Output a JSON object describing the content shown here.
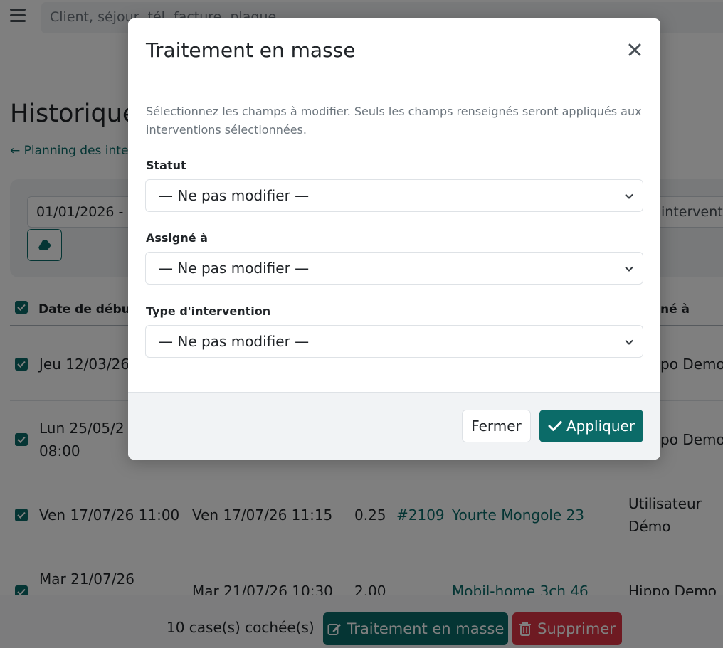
{
  "colors": {
    "accent": "#0b6b68",
    "danger": "#dc3545",
    "muted": "#6c757d"
  },
  "topbar": {
    "search_placeholder": "Client, séjour, tél, facture, plaque"
  },
  "page": {
    "title": "Historique",
    "back_link": "← Planning des inter"
  },
  "filters": {
    "date_value": "01/01/2026 -",
    "type_value": "intervent"
  },
  "table": {
    "headers": {
      "start": "Date de début",
      "assigned": "né à"
    },
    "rows": [
      {
        "start": "Jeu 12/03/26",
        "assigned": "po Demo"
      },
      {
        "start": "Lun 25/05/2",
        "start_time": "08:00",
        "assigned": "po Demo"
      },
      {
        "start": "Ven 17/07/26 11:00",
        "end": "Ven 17/07/26 11:15",
        "duration": "0.25",
        "number": "#2109",
        "location": "Yourte Mongole 23",
        "assigned": "Utilisateur Démo"
      },
      {
        "start": "Mar 21/07/26",
        "end": "Mar 21/07/26 10:30",
        "duration": "2.00",
        "location": "Mobil-home 3ch 46",
        "assigned": "Hippo Demo"
      }
    ]
  },
  "bulk_bar": {
    "count": "10 case(s) cochée(s)",
    "mass_label": "Traitement en masse",
    "delete_label": "Supprimer"
  },
  "modal": {
    "title": "Traitement en masse",
    "helper": "Sélectionnez les champs à modifier. Seuls les champs renseignés seront appliqués aux interventions sélectionnées.",
    "fields": [
      {
        "label": "Statut",
        "value": "— Ne pas modifier —"
      },
      {
        "label": "Assigné à",
        "value": "— Ne pas modifier —"
      },
      {
        "label": "Type d'intervention",
        "value": "— Ne pas modifier —"
      }
    ],
    "close_label": "Fermer",
    "apply_label": "Appliquer"
  }
}
